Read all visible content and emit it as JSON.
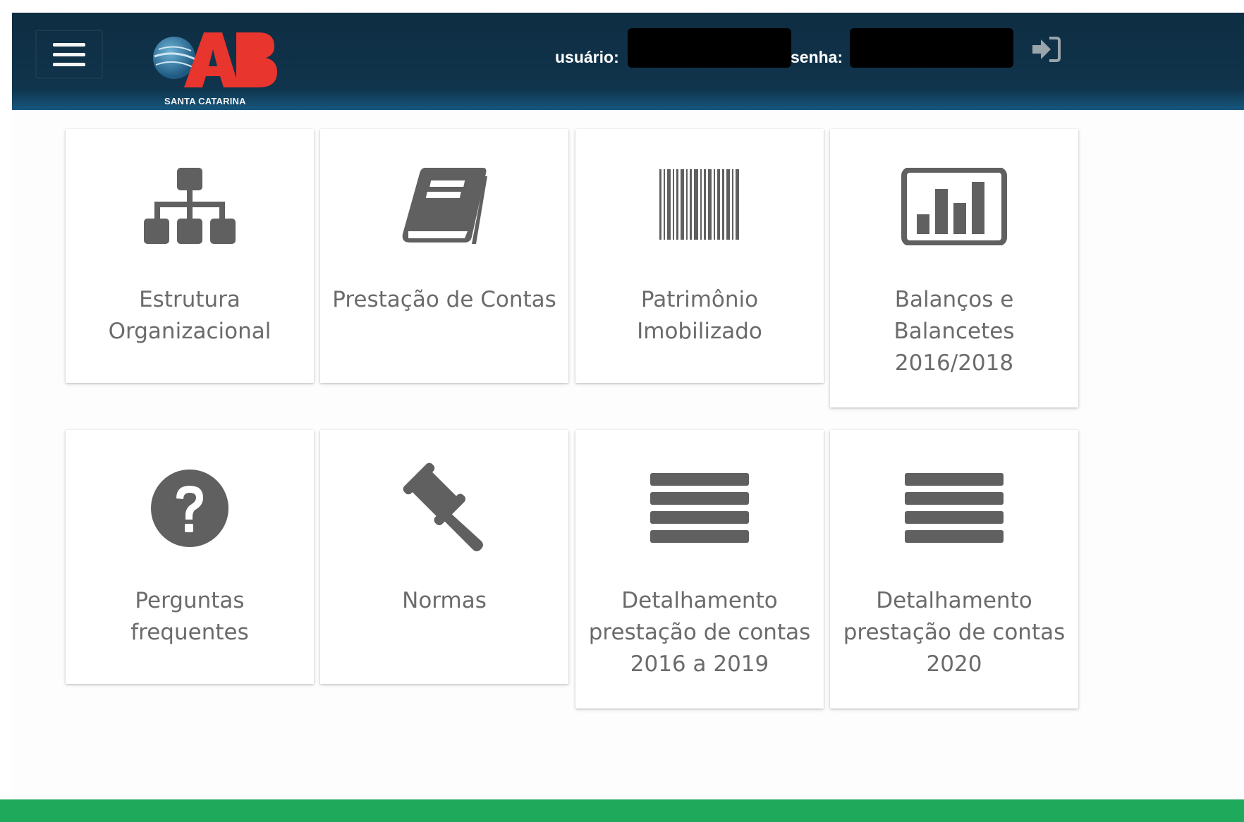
{
  "header": {
    "logo_caption": "SANTA CATARINA",
    "user_label": "usuário:",
    "password_label": "senha:",
    "user_value": "",
    "password_value": ""
  },
  "cards": [
    {
      "label": "Estrutura Organizacional",
      "icon": "sitemap-icon"
    },
    {
      "label": "Prestação de Contas",
      "icon": "book-icon"
    },
    {
      "label": "Patrimônio Imobilizado",
      "icon": "barcode-icon"
    },
    {
      "label": "Balanços e Balancetes 2016/2018",
      "icon": "bar-chart-icon"
    },
    {
      "label": "Perguntas frequentes",
      "icon": "question-circle-icon"
    },
    {
      "label": "Normas",
      "icon": "gavel-icon"
    },
    {
      "label": "Detalhamento prestação de contas 2016 a 2019",
      "icon": "list-icon"
    },
    {
      "label": "Detalhamento prestação de contas 2020",
      "icon": "list-icon"
    }
  ],
  "colors": {
    "header": "#10344c",
    "icon": "#606060",
    "card_text": "#6b6b6b",
    "footer": "#1fa95a",
    "logo_red": "#e8352d"
  }
}
